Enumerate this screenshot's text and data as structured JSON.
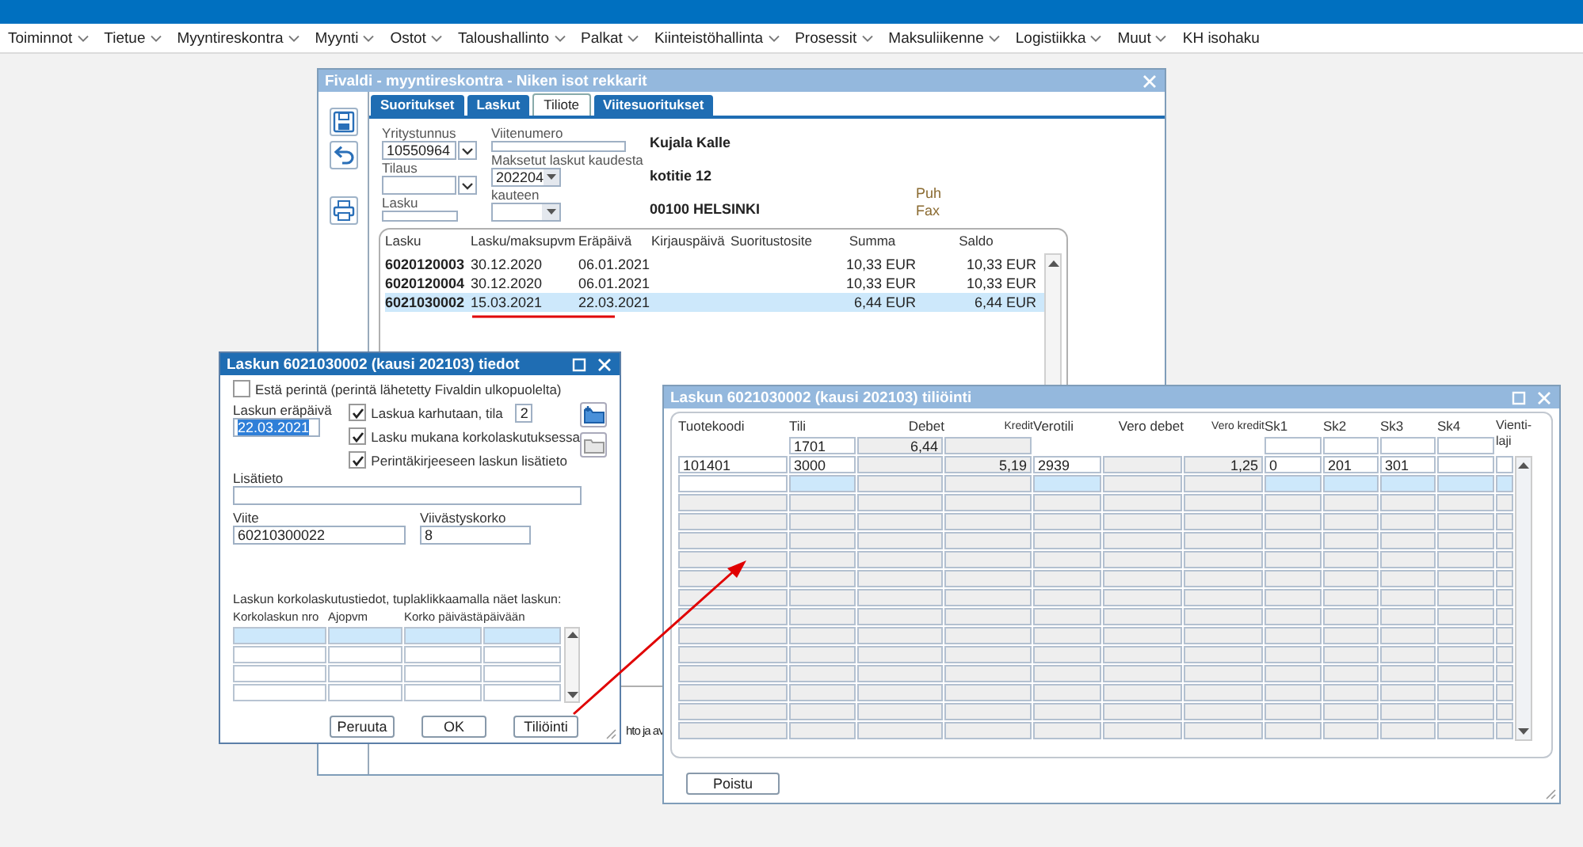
{
  "menu": [
    {
      "label": "Toiminnot",
      "has_dropdown": true
    },
    {
      "label": "Tietue",
      "has_dropdown": true
    },
    {
      "label": "Myyntireskontra",
      "has_dropdown": true
    },
    {
      "label": "Myynti",
      "has_dropdown": true
    },
    {
      "label": "Ostot",
      "has_dropdown": true
    },
    {
      "label": "Taloushallinto",
      "has_dropdown": true
    },
    {
      "label": "Palkat",
      "has_dropdown": true
    },
    {
      "label": "Kiinteistöhallinta",
      "has_dropdown": true
    },
    {
      "label": "Prosessit",
      "has_dropdown": true
    },
    {
      "label": "Maksuliikenne",
      "has_dropdown": true
    },
    {
      "label": "Logistiikka",
      "has_dropdown": true
    },
    {
      "label": "Muut",
      "has_dropdown": true
    },
    {
      "label": "KH isohaku",
      "has_dropdown": false
    }
  ],
  "main_window": {
    "title": "Fivaldi - myyntireskontra - Niken isot rekkarit",
    "tabs": [
      {
        "label": "Suoritukset",
        "selected": false
      },
      {
        "label": "Laskut",
        "selected": false
      },
      {
        "label": "Tiliote",
        "selected": true
      },
      {
        "label": "Viitesuoritukset",
        "selected": false
      }
    ],
    "form": {
      "company_id": {
        "label": "Yritystunnus",
        "value": "10550964"
      },
      "reference": {
        "label": "Viitenumero"
      },
      "order": {
        "label": "Tilaus"
      },
      "period_from": {
        "label": "Maksetut laskut kaudesta",
        "value": "202204"
      },
      "invoice": {
        "label": "Lasku"
      },
      "period_to": {
        "label": "kauteen"
      }
    },
    "customer": {
      "name": "Kujala Kalle",
      "street": "kotitie 12",
      "city": "00100 HELSINKI"
    },
    "contact_labels": [
      "Puh",
      "Fax"
    ],
    "table": {
      "columns": [
        "Lasku",
        "Lasku/maksupvm",
        "Eräpäivä",
        "Kirjauspäivä",
        "Suoritustosite",
        "Summa",
        "Saldo"
      ],
      "rows": [
        {
          "selected": false,
          "invoice": "6020120003",
          "invoice_date": "30.12.2020",
          "due_date": "06.01.2021",
          "amount": "10,33 EUR",
          "balance": "10,33 EUR"
        },
        {
          "selected": false,
          "invoice": "6020120004",
          "invoice_date": "30.12.2020",
          "due_date": "06.01.2021",
          "amount": "10,33 EUR",
          "balance": "10,33 EUR"
        },
        {
          "selected": true,
          "invoice": "6021030002",
          "invoice_date": "15.03.2021",
          "due_date": "22.03.2021",
          "amount": "6,44 EUR",
          "balance": "6,44 EUR"
        }
      ]
    },
    "footer_text": "hto ja av"
  },
  "invoice_dialog": {
    "title": "Laskun 6021030002 (kausi 202103) tiedot",
    "block_collection": {
      "label": "Estä perintä (perintä lähetetty Fivaldin ulkopuolelta)",
      "checked": false
    },
    "due_date": {
      "label": "Laskun eräpäivä",
      "value": "22.03.2021",
      "highlighted": true
    },
    "options": [
      {
        "label": "Laskua karhutaan, tila",
        "checked": true,
        "value": "2"
      },
      {
        "label": "Lasku mukana korkolaskutuksessa",
        "checked": true
      },
      {
        "label": "Perintäkirjeeseen laskun lisätieto",
        "checked": true
      }
    ],
    "extra_info": {
      "label": "Lisätieto"
    },
    "reference": {
      "label": "Viite",
      "value": "60210300022"
    },
    "late_interest": {
      "label": "Viivästyskorko",
      "value": "8"
    },
    "interest_caption": "Laskun korkolaskutustiedot, tuplaklikkaamalla näet laskun:",
    "interest_table": {
      "columns": [
        "Korkolaskun nro",
        "Ajopvm",
        "Korko päivästä",
        "päivään"
      ],
      "rows": [
        {
          "selected": true
        },
        {
          "selected": false
        },
        {
          "selected": false
        },
        {
          "selected": false
        }
      ]
    },
    "buttons": [
      "Peruuta",
      "OK",
      "Tiliöinti"
    ]
  },
  "posting_dialog": {
    "title": "Laskun 6021030002 (kausi 202103) tiliöinti",
    "columns": [
      {
        "label": "Tuotekoodi",
        "editable": true,
        "kind": "code"
      },
      {
        "label": "Tili",
        "editable": true,
        "kind": "code",
        "total": {
          "value": "1701",
          "editable": true
        }
      },
      {
        "label": "Debet",
        "editable": false,
        "kind": "amount",
        "total": {
          "value": "6,44",
          "editable": false
        }
      },
      {
        "label": "Kredit",
        "editable": false,
        "kind": "amount",
        "total": {
          "editable": false
        }
      },
      {
        "label": "Verotili",
        "editable": true,
        "kind": "code"
      },
      {
        "label": "Vero debet",
        "editable": false,
        "kind": "amount"
      },
      {
        "label": "Vero kredit",
        "editable": false,
        "kind": "amount"
      },
      {
        "label": "Sk1",
        "editable": true,
        "kind": "code",
        "total": {
          "editable": true
        }
      },
      {
        "label": "Sk2",
        "editable": true,
        "kind": "code",
        "total": {
          "editable": true
        }
      },
      {
        "label": "Sk3",
        "editable": true,
        "kind": "code",
        "total": {
          "editable": true
        }
      },
      {
        "label": "Sk4",
        "editable": true,
        "kind": "code",
        "total": {
          "editable": true
        }
      },
      {
        "label": "Vienti-laji",
        "editable": true,
        "kind": "code"
      }
    ],
    "rows": [
      {
        "selected": false,
        "cells": [
          {
            "value": "101401"
          },
          {
            "value": "3000"
          },
          {},
          {
            "value": "5,19"
          },
          {
            "value": "2939"
          },
          {},
          {
            "value": "1,25"
          },
          {
            "value": "0"
          },
          {
            "value": "201"
          },
          {
            "value": "301"
          },
          {},
          {}
        ]
      },
      {
        "selected": true
      },
      {
        "selected": false
      },
      {
        "selected": false
      },
      {
        "selected": false
      },
      {
        "selected": false
      },
      {
        "selected": false
      },
      {
        "selected": false
      },
      {
        "selected": false
      },
      {
        "selected": false
      },
      {
        "selected": false
      },
      {
        "selected": false
      },
      {
        "selected": false
      },
      {
        "selected": false
      },
      {
        "selected": false
      }
    ],
    "buttons": [
      "Poistu"
    ]
  }
}
